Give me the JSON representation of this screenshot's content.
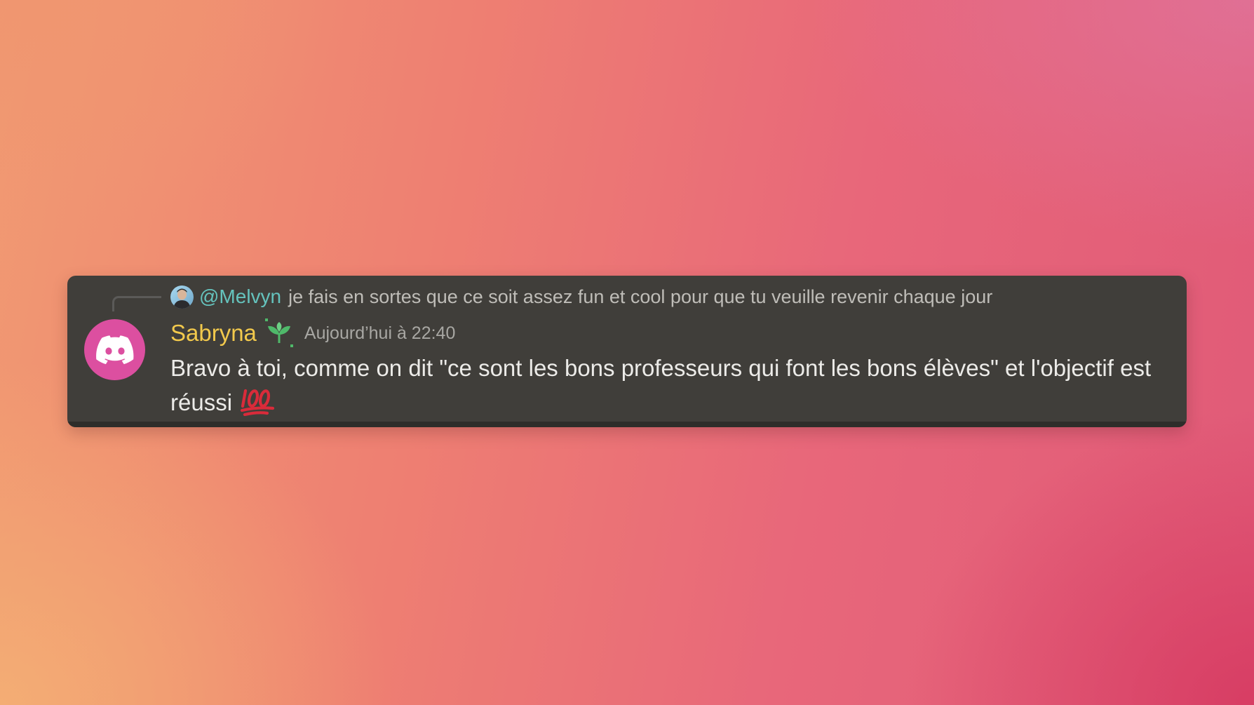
{
  "reply": {
    "mention": "@Melvyn",
    "text": "je fais en sortes que ce soit assez fun et cool pour que tu veuille revenir chaque jour"
  },
  "message": {
    "author": "Sabryna",
    "timestamp": "Aujourd’hui à 22:40",
    "line1": "Bravo à toi, comme on dit \"ce sont les bons professeurs qui font les bons élèves\"  et l'objectif est",
    "line2": "réussi",
    "emoji": "100-emoji"
  },
  "icons": {
    "avatar": "discord-logo-icon",
    "role": "sprout-icon",
    "reply_avatar": "user-avatar"
  },
  "colors": {
    "card": "#403e3a",
    "author": "#f2c94c",
    "mention": "#65c3bd",
    "avatar_bg": "#dc4fa0"
  }
}
